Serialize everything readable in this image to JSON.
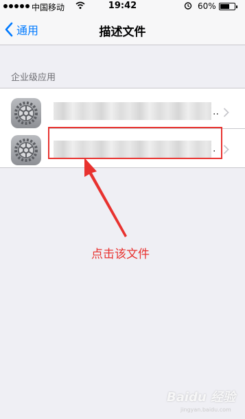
{
  "status_bar": {
    "carrier": "中国移动",
    "time": "19:42",
    "battery_percent": "60%"
  },
  "nav": {
    "back_label": "通用",
    "title": "描述文件"
  },
  "section": {
    "header": "企业级应用"
  },
  "profiles": [
    {
      "name": "..",
      "icon": "settings-gear-icon"
    },
    {
      "name": ".",
      "icon": "settings-gear-icon"
    }
  ],
  "annotation": {
    "text": "点击该文件",
    "color": "#e8322f"
  },
  "watermark": {
    "logo_text": "Baidu 经验",
    "sub": "jingyan.baidu.com"
  },
  "colors": {
    "accent": "#007aff",
    "background": "#efeff4"
  }
}
